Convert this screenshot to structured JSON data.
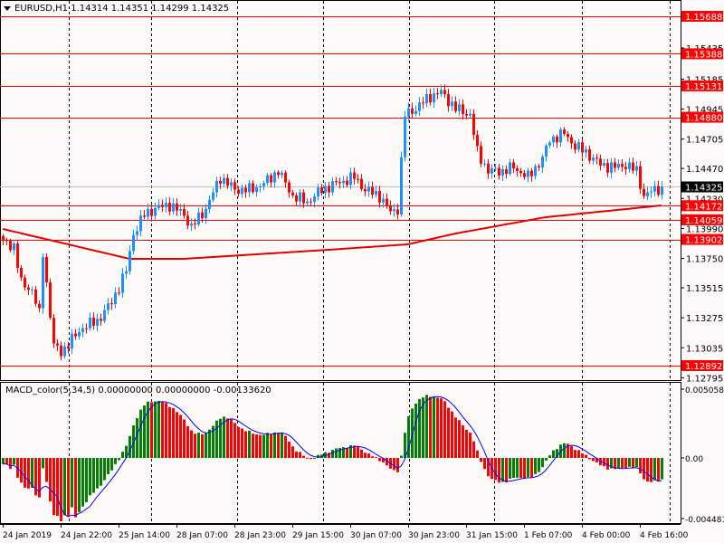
{
  "header": {
    "symbol": "EURUSD,H1",
    "ohlc": "1.14314 1.14351 1.14299 1.14325"
  },
  "macd_header": {
    "label": "MACD_color(5,34,5) 0.00000000 0.00000000 -0.00133620"
  },
  "colors": {
    "up": "#1e90ff",
    "down": "#ff0000",
    "grid": "#000000",
    "level": "#ff0000",
    "ma": "#e00000",
    "signal": "#0000ff",
    "hist_up": "#008000",
    "hist_down": "#ff0000"
  },
  "chart_data": {
    "type": "candlestick",
    "symbol": "EURUSD",
    "timeframe": "H1",
    "ylim": [
      1.12795,
      1.15688
    ],
    "price_ticks": [
      "1.15435",
      "1.15185",
      "1.14945",
      "1.14705",
      "1.14470",
      "1.14230",
      "1.13990",
      "1.13750",
      "1.13515",
      "1.13275",
      "1.13035",
      "1.12795"
    ],
    "levels": [
      "1.15688",
      "1.15388",
      "1.15131",
      "1.14880",
      "1.14172",
      "1.14059",
      "1.13902",
      "1.12892"
    ],
    "bid": "1.14325",
    "time_labels": [
      "24 Jan 2019",
      "24 Jan 22:00",
      "25 Jan 14:00",
      "28 Jan 07:00",
      "28 Jan 23:00",
      "29 Jan 15:00",
      "30 Jan 07:00",
      "30 Jan 23:00",
      "31 Jan 15:00",
      "1 Feb 07:00",
      "4 Feb 00:00",
      "4 Feb 16:00"
    ],
    "close_keypoints": [
      [
        0,
        1.1388
      ],
      [
        3,
        1.1385
      ],
      [
        5,
        1.1355
      ],
      [
        8,
        1.135
      ],
      [
        10,
        1.133
      ],
      [
        11,
        1.138
      ],
      [
        14,
        1.1305
      ],
      [
        16,
        1.13
      ],
      [
        19,
        1.131
      ],
      [
        22,
        1.132
      ],
      [
        26,
        1.1325
      ],
      [
        30,
        1.134
      ],
      [
        34,
        1.1365
      ],
      [
        36,
        1.1395
      ],
      [
        39,
        1.141
      ],
      [
        42,
        1.1415
      ],
      [
        46,
        1.1418
      ],
      [
        50,
        1.141
      ],
      [
        52,
        1.14
      ],
      [
        56,
        1.1415
      ],
      [
        60,
        1.144
      ],
      [
        64,
        1.143
      ],
      [
        68,
        1.143
      ],
      [
        72,
        1.1435
      ],
      [
        76,
        1.1445
      ],
      [
        80,
        1.1425
      ],
      [
        84,
        1.142
      ],
      [
        88,
        1.143
      ],
      [
        92,
        1.1435
      ],
      [
        97,
        1.144
      ],
      [
        100,
        1.143
      ],
      [
        104,
        1.1425
      ],
      [
        107,
        1.1412
      ],
      [
        109,
        1.1415
      ],
      [
        111,
        1.149
      ],
      [
        114,
        1.1495
      ],
      [
        118,
        1.1505
      ],
      [
        121,
        1.1508
      ],
      [
        125,
        1.1495
      ],
      [
        129,
        1.149
      ],
      [
        131,
        1.146
      ],
      [
        134,
        1.1445
      ],
      [
        138,
        1.1445
      ],
      [
        141,
        1.1448
      ],
      [
        145,
        1.144
      ],
      [
        149,
        1.1455
      ],
      [
        151,
        1.147
      ],
      [
        155,
        1.1475
      ],
      [
        158,
        1.1465
      ],
      [
        161,
        1.146
      ],
      [
        165,
        1.145
      ],
      [
        169,
        1.1448
      ],
      [
        172,
        1.145
      ],
      [
        175,
        1.1445
      ],
      [
        177,
        1.1425
      ],
      [
        180,
        1.143
      ],
      [
        182,
        1.14325
      ]
    ],
    "ma_keypoints": [
      [
        0,
        1.13986
      ],
      [
        35,
        1.13747
      ],
      [
        50,
        1.13747
      ],
      [
        90,
        1.13819
      ],
      [
        112,
        1.13863
      ],
      [
        125,
        1.13949
      ],
      [
        150,
        1.1408
      ],
      [
        182,
        1.14174
      ]
    ],
    "macd": {
      "params": "5,34,5",
      "ylim": [
        -0.004481,
        0.0050587
      ],
      "ticks": [
        "0.0050587",
        "0.00",
        "-0.004481"
      ]
    }
  }
}
